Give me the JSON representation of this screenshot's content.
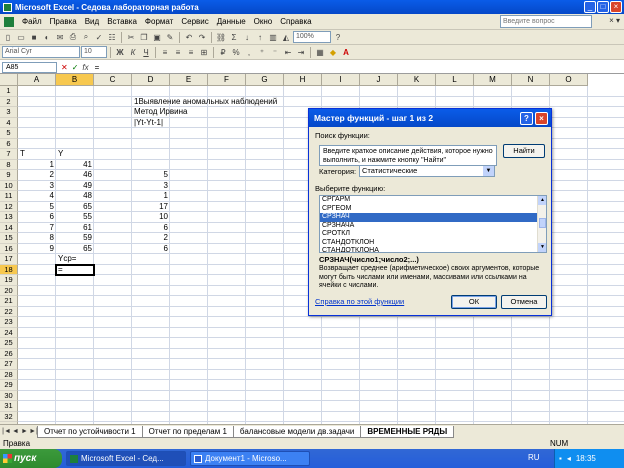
{
  "window": {
    "title": "Microsoft Excel - Седова лабораторная работа"
  },
  "menu": {
    "items": [
      "Файл",
      "Правка",
      "Вид",
      "Вставка",
      "Формат",
      "Сервис",
      "Данные",
      "Окно",
      "Справка"
    ],
    "ask_placeholder": "Введите вопрос"
  },
  "toolbar": {
    "font": "Arial Cyr",
    "size": "10",
    "zoom": "100%"
  },
  "formula": {
    "namebox": "A85",
    "value": "="
  },
  "grid": {
    "columns": [
      "A",
      "B",
      "C",
      "D",
      "E",
      "F",
      "G",
      "H",
      "I",
      "J",
      "K",
      "L",
      "M",
      "N",
      "O"
    ],
    "rows": [
      "1",
      "2",
      "3",
      "4",
      "5",
      "6",
      "7",
      "8",
      "9",
      "10",
      "11",
      "12",
      "13",
      "14",
      "15",
      "16",
      "17",
      "18",
      "19",
      "20",
      "21",
      "22",
      "23",
      "24",
      "25",
      "26",
      "27",
      "28",
      "29",
      "30",
      "31",
      "32",
      "33"
    ],
    "cells": {
      "d2": "1Выявление аномальных наблюдений",
      "d3": "Метод Ирвина",
      "d4": "|Yt-Yt-1|",
      "a7": "T",
      "b7": "Y",
      "a": [
        "1",
        "2",
        "3",
        "4",
        "5",
        "6",
        "7",
        "8",
        "9"
      ],
      "b": [
        "41",
        "46",
        "49",
        "48",
        "65",
        "55",
        "61",
        "59",
        "65"
      ],
      "d": [
        "5",
        "3",
        "1",
        "17",
        "10",
        "6",
        "2",
        "6"
      ],
      "b17": "Yср=",
      "b18": "="
    }
  },
  "sheets": {
    "tabs": [
      "Отчет по устойчивости 1",
      "Отчет по пределам 1",
      "балансовые модели дв.задачи",
      "ВРЕМЕННЫЕ РЯДЫ"
    ]
  },
  "status": {
    "left": "Правка",
    "num": "NUM"
  },
  "taskbar": {
    "start": "пуск",
    "items": [
      "Microsoft Excel - Сед...",
      "Документ1 - Microso..."
    ],
    "lang": "RU",
    "time": "18:35"
  },
  "dialog": {
    "title": "Мастер функций - шаг 1 из 2",
    "search_label": "Поиск функции:",
    "search_text": "Введите краткое описание действия, которое нужно выполнить, и нажмите кнопку \"Найти\"",
    "find_button": "Найти",
    "category_label": "Категория:",
    "category_value": "Статистические",
    "select_label": "Выберите функцию:",
    "functions": [
      "СРГАРМ",
      "СРГЕОМ",
      "СРЗНАЧ",
      "СРЗНАЧА",
      "СРОТКЛ",
      "СТАНДОТКЛОН",
      "СТАНДОТКЛОНА"
    ],
    "selected_index": 2,
    "syntax": "СРЗНАЧ(число1;число2;...)",
    "description": "Возвращает среднее (арифметическое) своих аргументов, которые могут быть числами или именами, массивами или ссылками на ячейки с числами.",
    "help_link": "Справка по этой функции",
    "ok": "ОК",
    "cancel": "Отмена"
  }
}
